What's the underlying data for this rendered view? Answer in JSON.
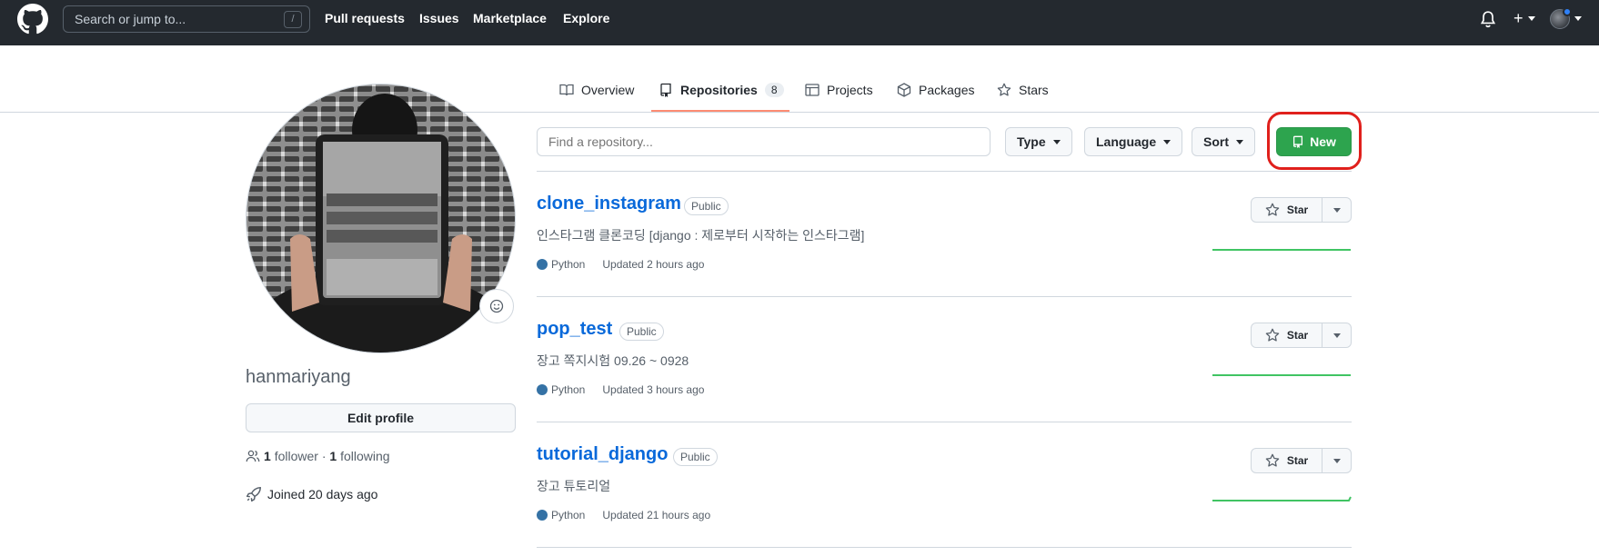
{
  "header": {
    "search_placeholder": "Search or jump to...",
    "search_shortcut": "/",
    "nav": [
      "Pull requests",
      "Issues",
      "Marketplace",
      "Explore"
    ],
    "plus_label": "+"
  },
  "tabs": [
    {
      "label": "Overview",
      "icon": "book-icon"
    },
    {
      "label": "Repositories",
      "icon": "repo-icon",
      "count": "8",
      "active": true
    },
    {
      "label": "Projects",
      "icon": "table-icon"
    },
    {
      "label": "Packages",
      "icon": "package-icon"
    },
    {
      "label": "Stars",
      "icon": "star-icon"
    }
  ],
  "profile": {
    "username": "hanmariyang",
    "edit_label": "Edit profile",
    "followers_count": "1",
    "followers_label": "follower",
    "separator": "·",
    "following_count": "1",
    "following_label": "following",
    "joined": "Joined 20 days ago"
  },
  "filters": {
    "find_placeholder": "Find a repository...",
    "type": "Type",
    "language": "Language",
    "sort": "Sort",
    "new_label": "New"
  },
  "repos": [
    {
      "name": "clone_instagram",
      "visibility": "Public",
      "description": "인스타그램 클론코딩 [django : 제로부터 시작하는 인스타그램]",
      "language": "Python",
      "updated": "Updated 2 hours ago",
      "star_label": "Star"
    },
    {
      "name": "pop_test",
      "visibility": "Public",
      "description": "장고 쪽지시험 09.26 ~ 0928",
      "language": "Python",
      "updated": "Updated 3 hours ago",
      "star_label": "Star"
    },
    {
      "name": "tutorial_django",
      "visibility": "Public",
      "description": "장고 튜토리얼",
      "language": "Python",
      "updated": "Updated 21 hours ago",
      "star_label": "Star"
    }
  ],
  "colors": {
    "header_bg": "#24292f",
    "accent_green": "#2da44e",
    "link_blue": "#0969da",
    "python": "#3572A5",
    "highlight_red": "#e0201c"
  }
}
